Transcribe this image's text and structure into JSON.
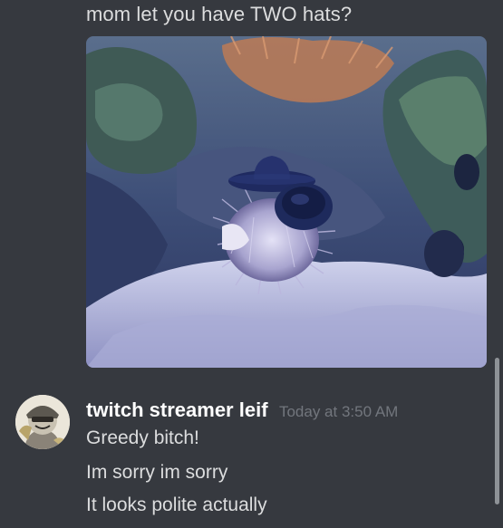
{
  "previous_message": {
    "text": "mom let you have TWO hats?"
  },
  "attachment": {
    "icon": "image-attachment"
  },
  "message": {
    "username": "twitch streamer leif",
    "timestamp": "Today at 3:50 AM",
    "avatar_icon": "user-avatar",
    "lines": [
      "Greedy bitch!",
      "Im sorry im sorry",
      "It looks polite actually"
    ]
  },
  "colors": {
    "background": "#36393f",
    "text": "#dcddde",
    "username": "#ffffff",
    "timestamp": "#72767d"
  }
}
